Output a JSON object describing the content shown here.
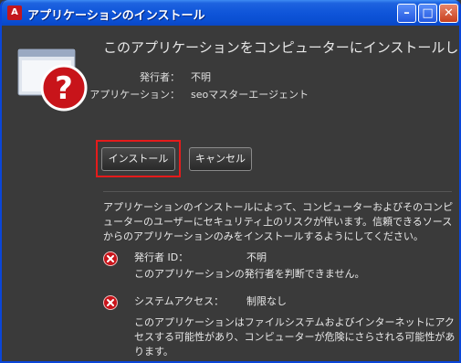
{
  "window": {
    "title": "アプリケーションのインストール",
    "app_logo_glyph": "A",
    "minimize_glyph": "–",
    "maximize_glyph": "□",
    "close_glyph": "✕"
  },
  "dialog": {
    "question": "このアプリケーションをコンピューターにインストールしますか？",
    "publisher_label": "発行者：",
    "publisher_value": "不明",
    "application_label": "アプリケーション：",
    "application_value": "seoマスターエージェント"
  },
  "buttons": {
    "install": "インストール",
    "cancel": "キャンセル"
  },
  "warning": {
    "text": "アプリケーションのインストールによって、コンピューターおよびそのコンピューターのユーザーにセキュリティ上のリスクが伴います。信頼できるソースからのアプリケーションのみをインストールするようにしてください。"
  },
  "details": [
    {
      "icon": "error-icon",
      "label": "発行者 ID：",
      "value": "不明",
      "description": "このアプリケーションの発行者を判断できません。"
    },
    {
      "icon": "error-icon",
      "label": "システムアクセス：",
      "value": "制限なし",
      "description": "このアプリケーションはファイルシステムおよびインターネットにアクセスする可能性があり、コンピューターが危険にさらされる可能性があります。"
    }
  ],
  "colors": {
    "titlebar": "#0a55d9",
    "background": "#3a3a3a",
    "highlight_box": "#e51b1b",
    "error_icon": "#c8141a"
  }
}
